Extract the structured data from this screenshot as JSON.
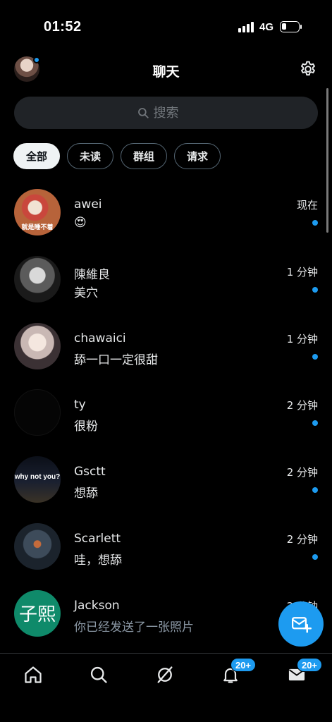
{
  "status_bar": {
    "time": "01:52",
    "network": "4G",
    "battery_level": 0.3
  },
  "header": {
    "title": "聊天",
    "avatar_has_notification": true,
    "settings_icon": "gear-icon"
  },
  "search": {
    "placeholder": "搜索",
    "value": ""
  },
  "filters": [
    {
      "label": "全部",
      "active": true
    },
    {
      "label": "未读",
      "active": false
    },
    {
      "label": "群组",
      "active": false
    },
    {
      "label": "请求",
      "active": false
    }
  ],
  "conversations": [
    {
      "name": "awei",
      "preview": "😍",
      "time": "现在",
      "unread": true,
      "avatar_caption": "就是睡不着"
    },
    {
      "name": "陳維良",
      "preview": "美穴",
      "time": "1 分钟",
      "unread": true
    },
    {
      "name": "chawaici",
      "preview": "舔一口一定很甜",
      "time": "1 分钟",
      "unread": true
    },
    {
      "name": "ty",
      "preview": "很粉",
      "time": "2 分钟",
      "unread": true
    },
    {
      "name": "Gsctt",
      "preview": "想舔",
      "time": "2 分钟",
      "unread": true,
      "avatar_caption": "why not you?"
    },
    {
      "name": "Scarlett",
      "preview": "哇，想舔",
      "time": "2 分钟",
      "unread": true
    },
    {
      "name": "Jackson",
      "preview": "你已经发送了一张照片",
      "time": "2 分钟",
      "unread": false,
      "avatar_text": "子熙"
    }
  ],
  "bottom_nav": {
    "items": [
      {
        "name": "home",
        "icon": "home-icon"
      },
      {
        "name": "search",
        "icon": "search-icon"
      },
      {
        "name": "grok",
        "icon": "slash-circle-icon"
      },
      {
        "name": "notifications",
        "icon": "bell-icon",
        "badge": "20+"
      },
      {
        "name": "messages",
        "icon": "envelope-icon",
        "badge": "20+"
      }
    ]
  },
  "fab": {
    "icon": "new-message-icon"
  },
  "colors": {
    "accent": "#1d9bf0",
    "background": "#000000",
    "search_bg": "#202327"
  }
}
